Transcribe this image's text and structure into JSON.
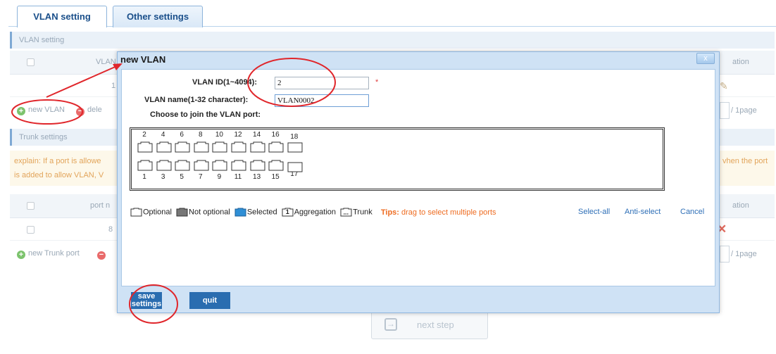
{
  "tabs": [
    {
      "label": "VLAN setting",
      "active": true
    },
    {
      "label": "Other settings",
      "active": false
    }
  ],
  "vlan_section": {
    "title": "VLAN setting",
    "col_vlan": "VLAN",
    "col_action": "ation",
    "row_value": "1",
    "new_vlan": "new VLAN",
    "delete": "dele",
    "page_suffix": "/ 1page"
  },
  "trunk_section": {
    "title": "Trunk settings",
    "explain_label": "explain:",
    "explain_line1": "If a port is allowe",
    "explain_line2": "is added to allow VLAN, V",
    "explain_tail": "vhen the port",
    "col_port": "port n",
    "col_action": "ation",
    "row_value": "8",
    "new_trunk": "new Trunk port",
    "page_suffix": "/ 1page"
  },
  "next_step": "next step",
  "modal": {
    "title": "new VLAN",
    "close_label": "x",
    "vlan_id_label": "VLAN ID(1~4094):",
    "vlan_id_value": "2",
    "required_mark": "*",
    "vlan_name_label": "VLAN name(1-32 character):",
    "vlan_name_value": "VLAN0002",
    "choose_label": "Choose to join the VLAN port:",
    "top_ports": [
      "2",
      "4",
      "6",
      "8",
      "10",
      "12",
      "14",
      "16",
      "18"
    ],
    "bottom_ports": [
      "1",
      "3",
      "5",
      "7",
      "9",
      "11",
      "13",
      "15",
      "17"
    ],
    "legend": {
      "optional": "Optional",
      "not_optional": "Not optional",
      "selected": "Selected",
      "aggregation_badge": "1",
      "aggregation": "Aggregation",
      "trunk": "Trunk",
      "tips_label": "Tips:",
      "tips_text": "drag to select multiple ports",
      "select_all": "Select-all",
      "anti_select": "Anti-select",
      "cancel": "Cancel"
    },
    "save_button": "save settings",
    "quit_button": "quit"
  },
  "colors": {
    "accent": "#2a6db0",
    "annotation": "#e0262b",
    "tips": "#ee6c21",
    "link": "#2e6fb7"
  }
}
